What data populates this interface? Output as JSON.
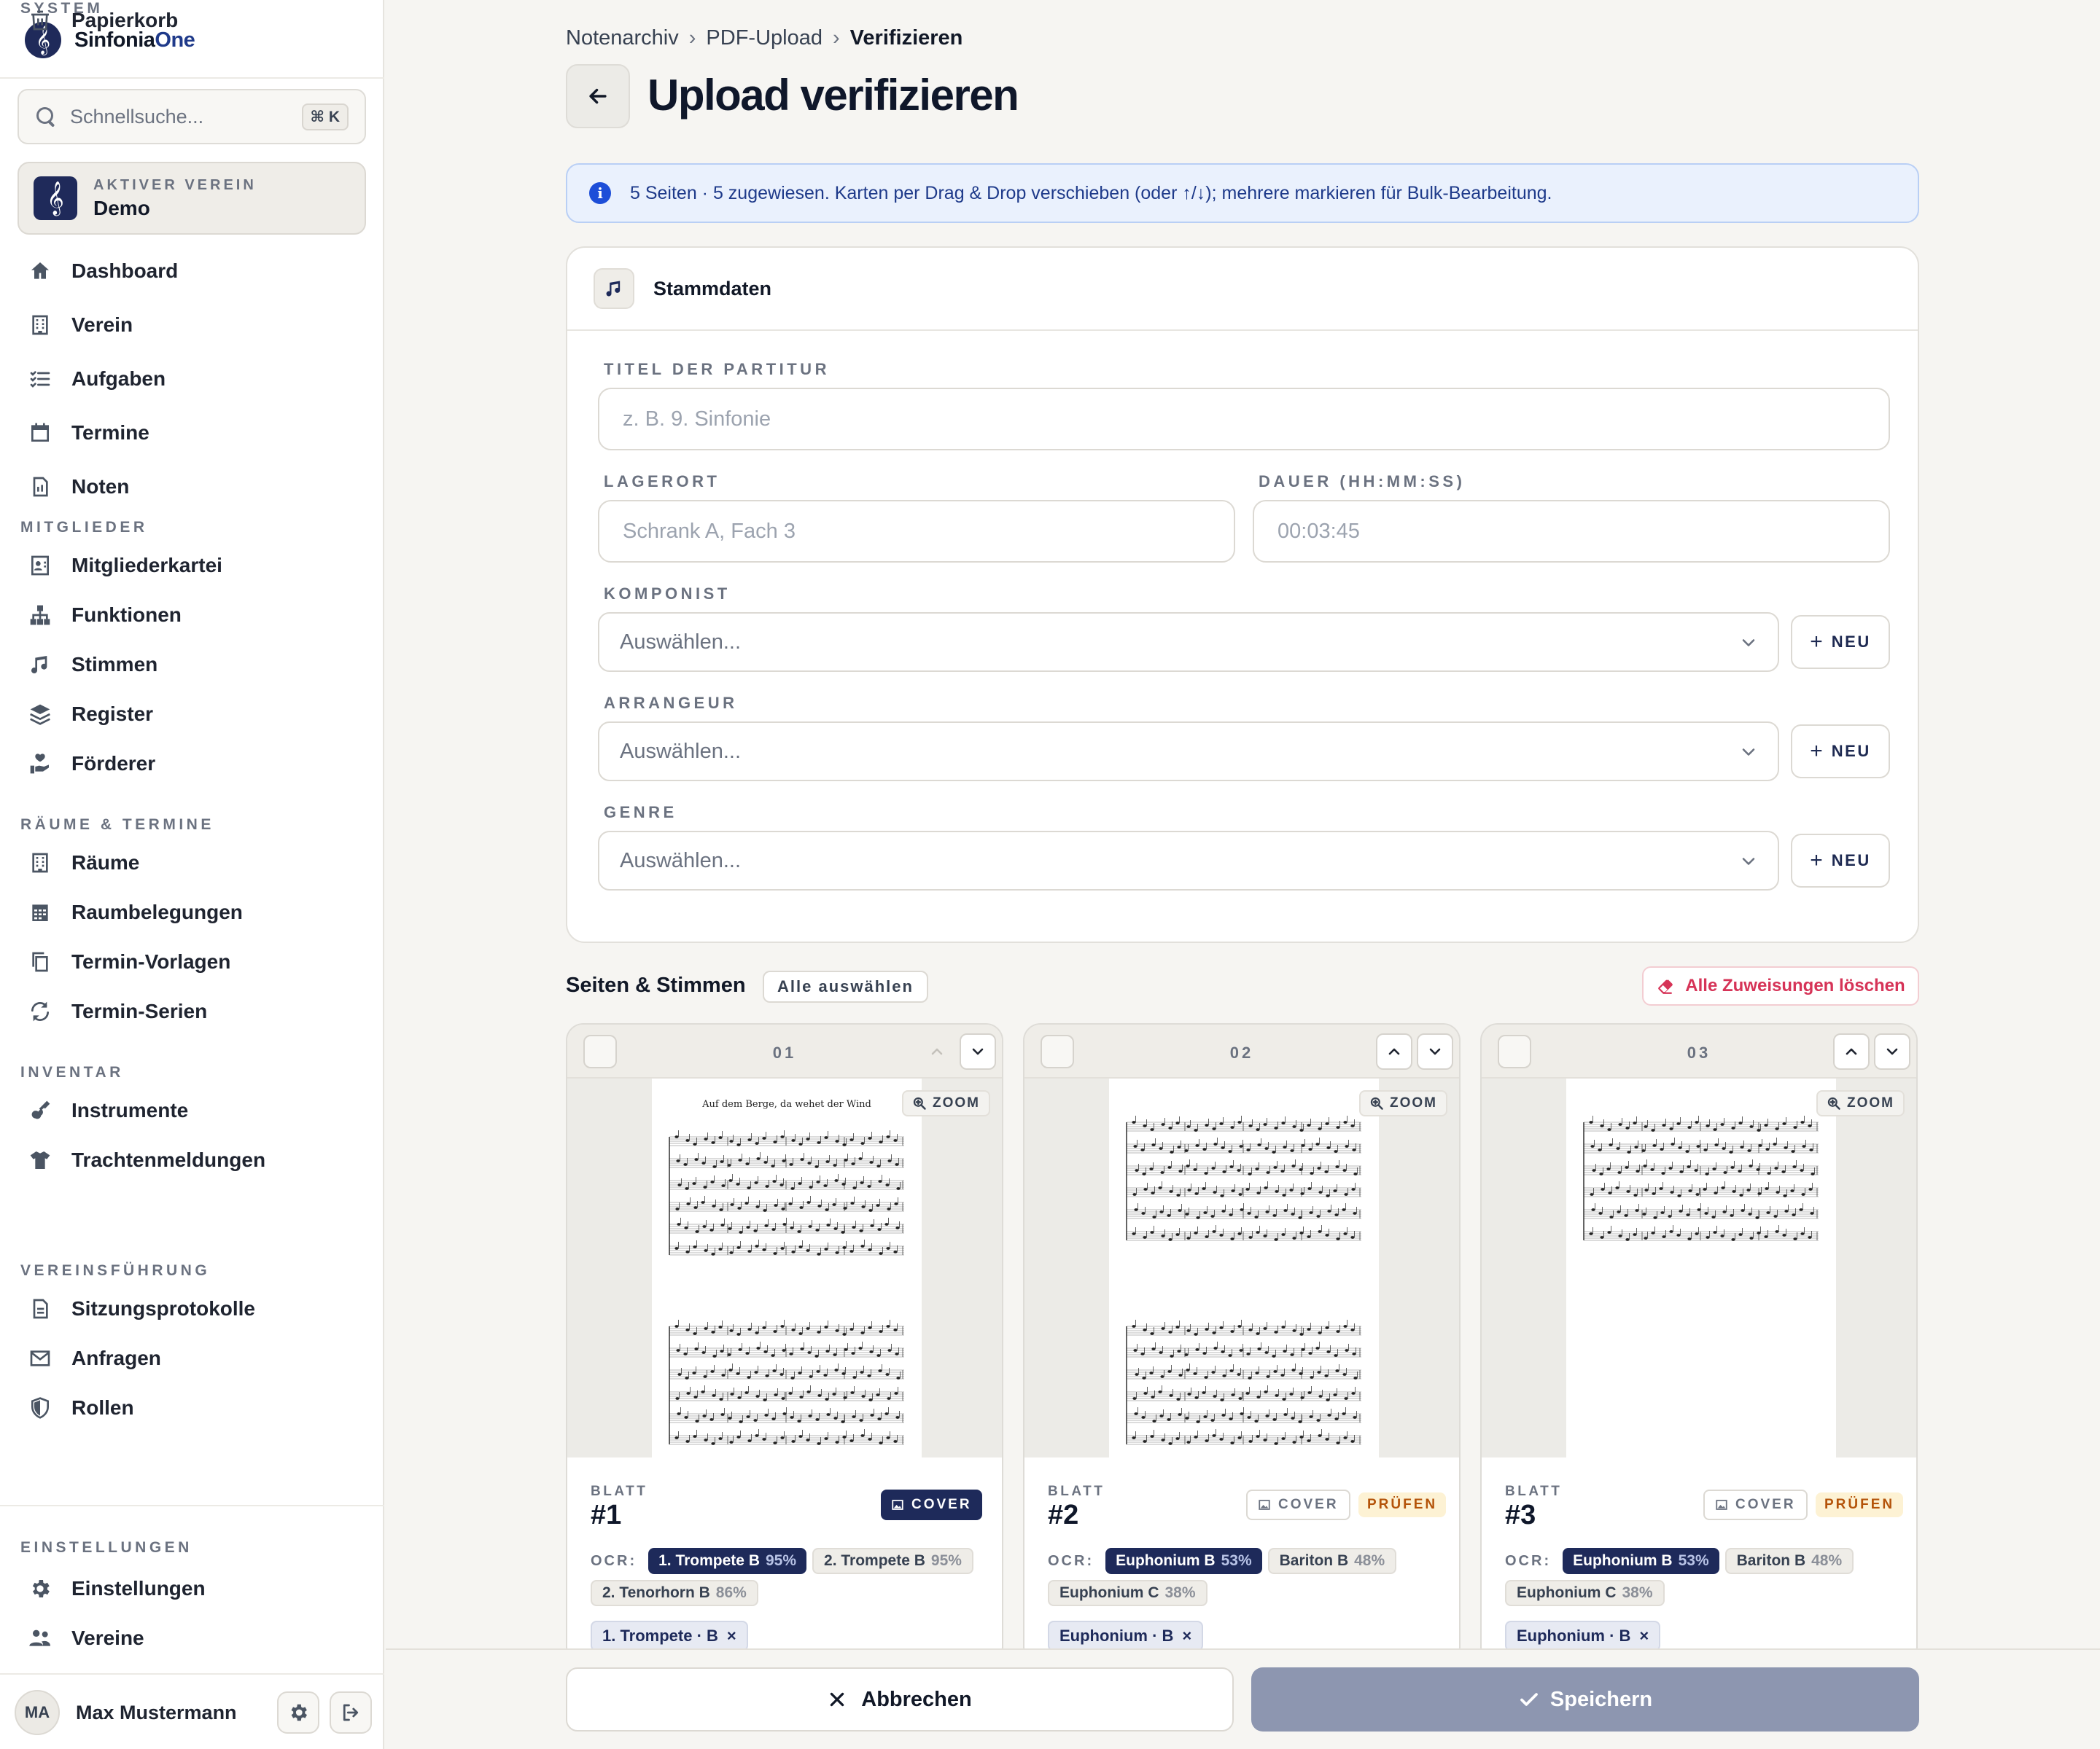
{
  "app": {
    "name_main": "Sinfonia",
    "name_accent": "One"
  },
  "search": {
    "placeholder": "Schnellsuche...",
    "shortcut": "⌘ K"
  },
  "club": {
    "label": "AKTIVER VEREIN",
    "name": "Demo"
  },
  "nav": {
    "main": [
      {
        "label": "Dashboard",
        "icon": "home-icon"
      },
      {
        "label": "Verein",
        "icon": "building-icon"
      },
      {
        "label": "Aufgaben",
        "icon": "checklist-icon"
      },
      {
        "label": "Termine",
        "icon": "calendar-icon"
      },
      {
        "label": "Noten",
        "icon": "sheet-music-icon"
      }
    ],
    "sections": [
      {
        "title": "MITGLIEDER",
        "items": [
          {
            "label": "Mitgliederkartei",
            "icon": "id-card-icon"
          },
          {
            "label": "Funktionen",
            "icon": "org-chart-icon"
          },
          {
            "label": "Stimmen",
            "icon": "music-note-icon"
          },
          {
            "label": "Register",
            "icon": "layers-icon"
          },
          {
            "label": "Förderer",
            "icon": "hand-heart-icon"
          }
        ]
      },
      {
        "title": "RÄUME & TERMINE",
        "items": [
          {
            "label": "Räume",
            "icon": "building-icon"
          },
          {
            "label": "Raumbelegungen",
            "icon": "calendar-grid-icon"
          },
          {
            "label": "Termin-Vorlagen",
            "icon": "copy-icon"
          },
          {
            "label": "Termin-Serien",
            "icon": "repeat-icon"
          }
        ]
      },
      {
        "title": "INVENTAR",
        "items": [
          {
            "label": "Instrumente",
            "icon": "guitar-icon"
          },
          {
            "label": "Trachtenmeldungen",
            "icon": "shirt-icon"
          }
        ]
      },
      {
        "title": "VEREINSFÜHRUNG",
        "items": [
          {
            "label": "Sitzungsprotokolle",
            "icon": "document-icon"
          },
          {
            "label": "Anfragen",
            "icon": "mail-icon"
          },
          {
            "label": "Rollen",
            "icon": "shield-icon"
          }
        ]
      },
      {
        "title": "SYSTEM",
        "items": [
          {
            "label": "Papierkorb",
            "icon": "trash-icon"
          }
        ]
      }
    ],
    "settings_title": "EINSTELLUNGEN",
    "settings_items": [
      {
        "label": "Einstellungen",
        "icon": "gear-icon"
      },
      {
        "label": "Vereine",
        "icon": "users-icon"
      }
    ]
  },
  "user": {
    "initials": "MA",
    "name": "Max Mustermann"
  },
  "breadcrumb": [
    "Notenarchiv",
    "PDF-Upload",
    "Verifizieren"
  ],
  "page": {
    "title": "Upload verifizieren"
  },
  "info": {
    "text": "5 Seiten · 5 zugewiesen. Karten per Drag & Drop verschieben (oder ↑/↓); mehrere markieren für Bulk-Bearbeitung."
  },
  "stammdaten": {
    "title": "Stammdaten",
    "titel_label": "TITEL DER PARTITUR",
    "titel_placeholder": "z. B. 9. Sinfonie",
    "lagerort_label": "LAGERORT",
    "lagerort_placeholder": "Schrank A, Fach 3",
    "dauer_label": "DAUER (HH:MM:SS)",
    "dauer_placeholder": "00:03:45",
    "komponist_label": "KOMPONIST",
    "arrangeur_label": "ARRANGEUR",
    "genre_label": "GENRE",
    "select_placeholder": "Auswählen...",
    "new_label": "NEU"
  },
  "pages_section": {
    "title": "Seiten & Stimmen",
    "select_all": "Alle auswählen",
    "clear_all": "Alle Zuweisungen löschen",
    "zoom_label": "ZOOM",
    "blatt_label": "BLATT",
    "cover_label": "COVER",
    "pruefen_label": "PRÜFEN",
    "ocr_label": "OCR:",
    "cards": [
      {
        "num": "01",
        "blatt": "#1",
        "cover": true,
        "pruefen": false,
        "sheet_title": "Auf dem Berge, da wehet der Wind",
        "ocr": [
          {
            "name": "1. Trompete B",
            "pct": "95%",
            "selected": true
          },
          {
            "name": "2. Trompete B",
            "pct": "95%",
            "selected": false
          },
          {
            "name": "2. Tenorhorn B",
            "pct": "86%",
            "selected": false
          }
        ],
        "assigned": "1. Trompete · B"
      },
      {
        "num": "02",
        "blatt": "#2",
        "cover": false,
        "pruefen": true,
        "sheet_title": "",
        "ocr": [
          {
            "name": "Euphonium B",
            "pct": "53%",
            "selected": true
          },
          {
            "name": "Bariton B",
            "pct": "48%",
            "selected": false
          },
          {
            "name": "Euphonium C",
            "pct": "38%",
            "selected": false
          }
        ],
        "assigned": "Euphonium · B"
      },
      {
        "num": "03",
        "blatt": "#3",
        "cover": false,
        "pruefen": true,
        "sheet_title": "",
        "ocr": [
          {
            "name": "Euphonium B",
            "pct": "53%",
            "selected": true
          },
          {
            "name": "Bariton B",
            "pct": "48%",
            "selected": false
          },
          {
            "name": "Euphonium C",
            "pct": "38%",
            "selected": false
          }
        ],
        "assigned": "Euphonium · B"
      }
    ]
  },
  "footer": {
    "cancel": "Abbrechen",
    "save": "Speichern"
  },
  "colors": {
    "brand": "#1f2a5a",
    "accent": "#1f3a8a",
    "danger": "#d63357",
    "save_disabled": "#8d96b0",
    "info_bg": "#eaf1fd"
  }
}
